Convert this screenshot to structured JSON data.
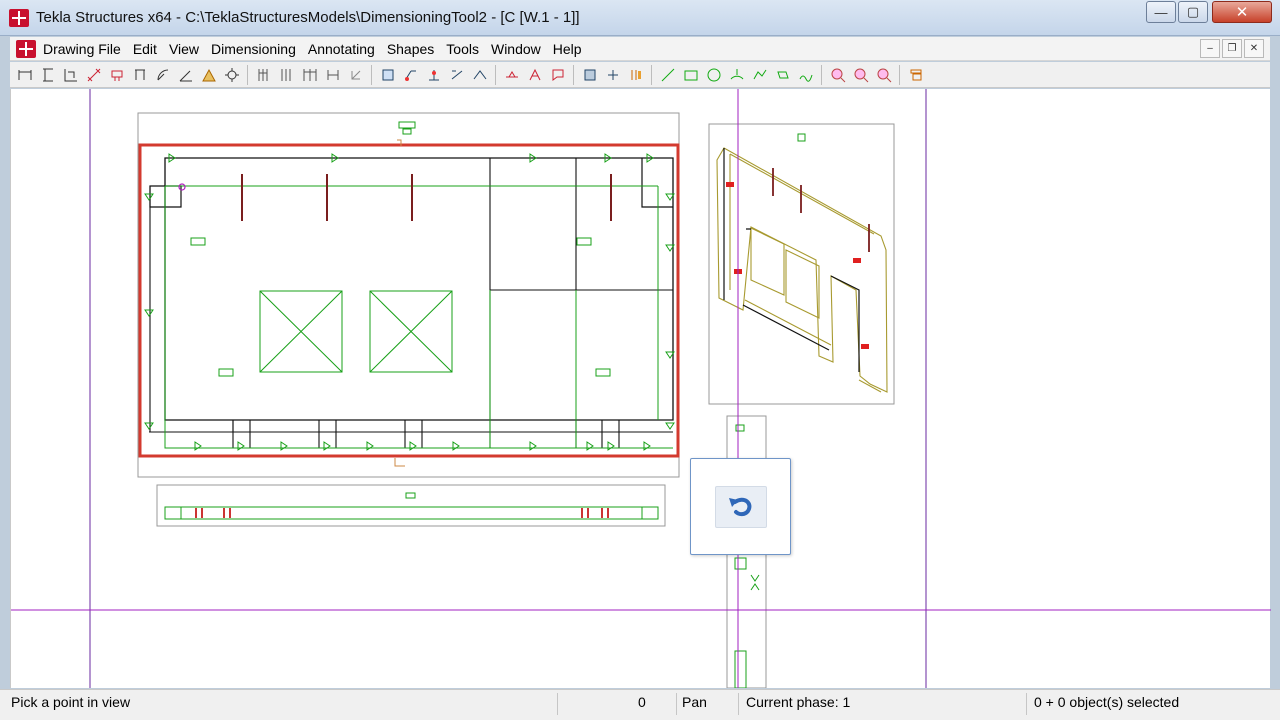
{
  "window": {
    "title": "Tekla Structures x64 - C:\\TeklaStructuresModels\\DimensioningTool2  - [C   [W.1 - 1]]",
    "minimize": "—",
    "maximize": "▢",
    "close": "✕"
  },
  "menu": {
    "items": [
      "Drawing File",
      "Edit",
      "View",
      "Dimensioning",
      "Annotating",
      "Shapes",
      "Tools",
      "Window",
      "Help"
    ],
    "mdi_minimize": "–",
    "mdi_restore": "❐",
    "mdi_close": "✕"
  },
  "colors": {
    "selection_red": "#d33a2f",
    "part_green": "#18a018",
    "crosshair_purple": "#a020c0",
    "accent_blue": "#3a78c8"
  },
  "status": {
    "prompt": "Pick a point in view",
    "count": "0",
    "mode": "Pan",
    "phase": "Current phase: 1",
    "selection": "0 + 0 object(s) selected"
  },
  "undo": {
    "icon": "undo-icon"
  }
}
